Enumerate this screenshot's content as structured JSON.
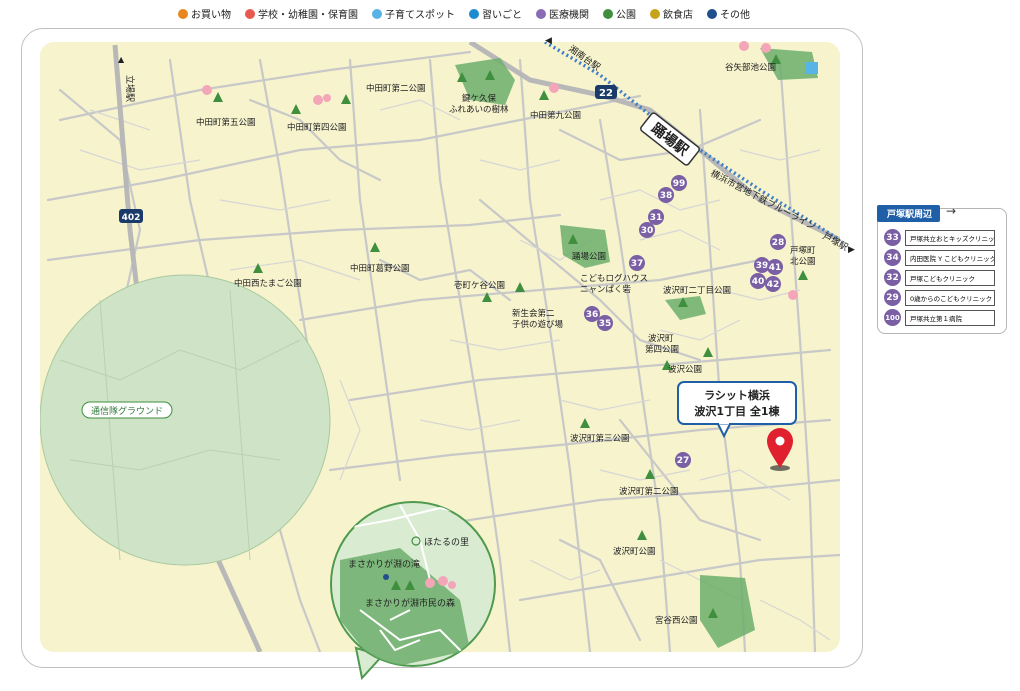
{
  "legend": [
    {
      "label": "お買い物",
      "color": "#e8871e"
    },
    {
      "label": "学校・幼稚園・保育園",
      "color": "#e85a4f"
    },
    {
      "label": "子育てスポット",
      "color": "#58b4e6"
    },
    {
      "label": "習いごと",
      "color": "#1d8ccf"
    },
    {
      "label": "医療機関",
      "color": "#8a6bb5"
    },
    {
      "label": "公園",
      "color": "#3f8f3f"
    },
    {
      "label": "飲食店",
      "color": "#c7a21a"
    },
    {
      "label": "その他",
      "color": "#1f4f8c"
    }
  ],
  "colors": {
    "land": "#f6f3cd",
    "park": "#6cae6c",
    "road": "#c8c8c8",
    "medical": "#7a5fa5",
    "pin": "#e0202e",
    "rail": "#3f7ec8"
  },
  "stations": {
    "odoriba": "踊場駅",
    "shonandai": "湘南台駅",
    "tachiba": "立場駅",
    "totsuka": "戸塚駅",
    "line": "横浜市営地下鉄ブルーライン"
  },
  "roads": {
    "r22": "22",
    "r402": "402"
  },
  "parks": {
    "nakada5": "中田町第五公園",
    "nakada4": "中田町第四公園",
    "nakada2": "中田町第二公園",
    "hanakubo": "鍵ケ久保",
    "hanakubo2": "ふれあいの樹林",
    "nakada9": "中田第九公園",
    "yaho": "谷矢部池公園",
    "nakadanishi": "中田西たまご公園",
    "nakadakaya": "中田町葛野公園",
    "yotsugaya": "壱町ケ谷公園",
    "shinseikai": "新生会第二",
    "shinseikai2": "子供の遊び場",
    "odoriba": "踊場公園",
    "kodomo": "こどもログハウス",
    "kodomo2": "ニャンぱく砦",
    "namisawa2": "波沢町二丁目公園",
    "namisawa4": "波沢町",
    "namisawa4b": "第四公園",
    "namisawa": "波沢公園",
    "totsukakita": "戸塚町",
    "totsukakita2": "北公園",
    "namisawa3": "波沢町第三公園",
    "namisawa2b": "波沢町第二公園",
    "namisawacho": "波沢町公園",
    "miyakonishi": "宮谷西公園",
    "ground": "通信隊グラウンド"
  },
  "inset": {
    "hotaru": "ほたるの里",
    "taki": "まさかりが淵の滝",
    "mori": "まさかりが淵市民の森"
  },
  "property": {
    "line1": "ラシット横浜",
    "line2": "波沢1丁目 全1棟"
  },
  "markers": [
    "99",
    "38",
    "31",
    "30",
    "37",
    "36",
    "35",
    "27",
    "28",
    "39",
    "41",
    "40",
    "42"
  ],
  "sidebar": {
    "title": "戸塚駅周辺",
    "items": [
      {
        "num": "33",
        "label": "戸塚共立おとキッズクリニック"
      },
      {
        "num": "34",
        "label": "内田医院 Y こどもクリニック"
      },
      {
        "num": "32",
        "label": "戸塚こどもクリニック"
      },
      {
        "num": "29",
        "label": "0歳からのこどもクリニック"
      },
      {
        "num": "100",
        "label": "戸塚共立第１病院"
      }
    ]
  }
}
